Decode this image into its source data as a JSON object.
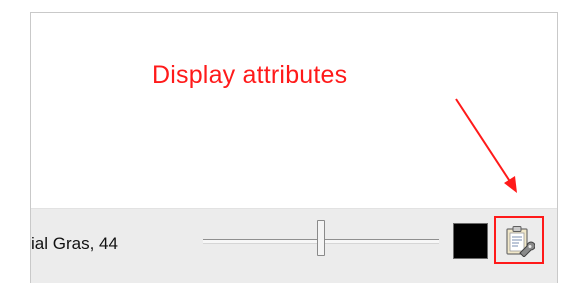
{
  "annotation": {
    "text": "Display attributes",
    "color": "#ff1a1a"
  },
  "toolbar": {
    "font_label": "ial Gras, 44",
    "size_slider": {
      "level_fraction": 0.5
    },
    "color_swatch": {
      "color": "#000000"
    },
    "display_attributes_button": {
      "icon": "clipboard-wrench-icon",
      "highlight_color": "#ff1a1a"
    }
  }
}
